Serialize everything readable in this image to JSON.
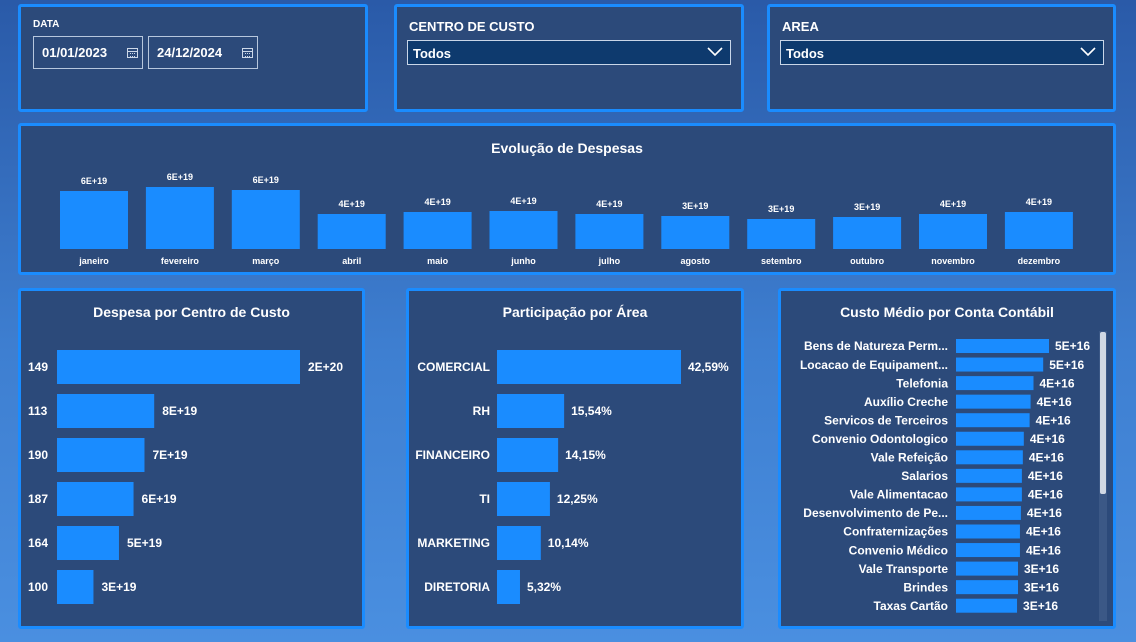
{
  "filters": {
    "data": {
      "label": "DATA",
      "start": "01/01/2023",
      "end": "24/12/2024",
      "icon": "calendar-icon"
    },
    "centro_custo": {
      "label": "CENTRO DE CUSTO",
      "selected": "Todos",
      "icon": "chevron-down-icon"
    },
    "area": {
      "label": "AREA",
      "selected": "Todos",
      "icon": "chevron-down-icon"
    }
  },
  "colors": {
    "accent": "#1a8cff",
    "bar": "#1a8cff",
    "card": "#2c4a7a"
  },
  "chart_data": [
    {
      "type": "bar",
      "title": "Evolução de Despesas",
      "categories": [
        "janeiro",
        "fevereiro",
        "março",
        "abril",
        "maio",
        "junho",
        "julho",
        "agosto",
        "setembro",
        "outubro",
        "novembro",
        "dezembro"
      ],
      "values": [
        5.8e+19,
        6.2e+19,
        5.9e+19,
        3.5e+19,
        3.7e+19,
        3.8e+19,
        3.5e+19,
        3.3e+19,
        3e+19,
        3.2e+19,
        3.5e+19,
        3.7e+19
      ],
      "data_labels": [
        "6E+19",
        "6E+19",
        "6E+19",
        "4E+19",
        "4E+19",
        "4E+19",
        "4E+19",
        "3E+19",
        "3E+19",
        "3E+19",
        "4E+19",
        "4E+19"
      ],
      "grid": false
    },
    {
      "type": "bar",
      "orientation": "horizontal",
      "title": "Despesa por Centro de Custo",
      "categories": [
        "149",
        "113",
        "190",
        "187",
        "164",
        "100"
      ],
      "values": [
        2e+20,
        8e+19,
        7.2e+19,
        6.3e+19,
        5.1e+19,
        3e+19
      ],
      "data_labels": [
        "2E+20",
        "8E+19",
        "7E+19",
        "6E+19",
        "5E+19",
        "3E+19"
      ]
    },
    {
      "type": "bar",
      "orientation": "horizontal",
      "title": "Participação por Área",
      "categories": [
        "COMERCIAL",
        "RH",
        "FINANCEIRO",
        "TI",
        "MARKETING",
        "DIRETORIA"
      ],
      "values": [
        42.59,
        15.54,
        14.15,
        12.25,
        10.14,
        5.32
      ],
      "data_labels": [
        "42,59%",
        "15,54%",
        "14,15%",
        "12,25%",
        "10,14%",
        "5,32%"
      ]
    },
    {
      "type": "bar",
      "orientation": "horizontal",
      "title": "Custo Médio por Conta Contábil",
      "categories": [
        "Bens de Natureza Perm...",
        "Locacao de Equipament...",
        "Telefonia",
        "Auxílio Creche",
        "Servicos de Terceiros",
        "Convenio Odontologico",
        "Vale Refeição",
        "Salarios",
        "Vale Alimentacao",
        "Desenvolvimento de Pe...",
        "Confraternizações",
        "Convenio Médico",
        "Vale Transporte",
        "Brindes",
        "Taxas Cartão"
      ],
      "values": [
        4.8e+16,
        4.5e+16,
        4e+16,
        3.85e+16,
        3.8e+16,
        3.5e+16,
        3.45e+16,
        3.4e+16,
        3.4e+16,
        3.35e+16,
        3.3e+16,
        3.3e+16,
        3.2e+16,
        3.2e+16,
        3.15e+16
      ],
      "data_labels": [
        "5E+16",
        "5E+16",
        "4E+16",
        "4E+16",
        "4E+16",
        "4E+16",
        "4E+16",
        "4E+16",
        "4E+16",
        "4E+16",
        "4E+16",
        "4E+16",
        "3E+16",
        "3E+16",
        "3E+16"
      ],
      "scrollbar": true
    }
  ]
}
